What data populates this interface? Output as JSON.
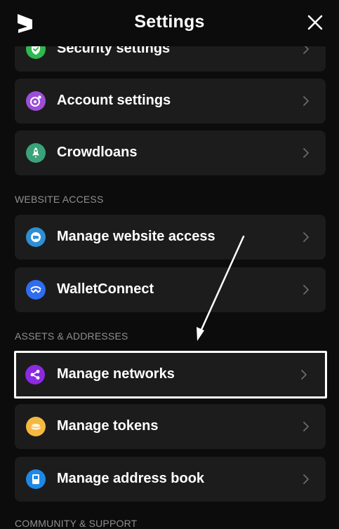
{
  "header": {
    "title": "Settings",
    "logo": "subwallet-logo",
    "close_icon": "close-icon"
  },
  "sections": {
    "website_access": "WEBSITE ACCESS",
    "assets_addresses": "ASSETS & ADDRESSES",
    "community_support": "COMMUNITY & SUPPORT"
  },
  "items": {
    "security": {
      "label": "Security settings",
      "icon": "shield-check-icon",
      "color": "#2fb84f"
    },
    "account": {
      "label": "Account settings",
      "icon": "account-settings-icon",
      "color": "#9c4fd6"
    },
    "crowdloans": {
      "label": "Crowdloans",
      "icon": "rocket-icon",
      "color": "#3aa37a"
    },
    "website": {
      "label": "Manage website access",
      "icon": "globe-icon",
      "color": "#2d8fd6"
    },
    "walletconnect": {
      "label": "WalletConnect",
      "icon": "walletconnect-icon",
      "color": "#2f6cf0"
    },
    "networks": {
      "label": "Manage networks",
      "icon": "share-network-icon",
      "color": "#8a2be2"
    },
    "tokens": {
      "label": "Manage tokens",
      "icon": "coins-icon",
      "color": "#f5b942"
    },
    "addressbook": {
      "label": "Manage address book",
      "icon": "book-icon",
      "color": "#1e88e5"
    }
  },
  "annotation": {
    "type": "pointer-arrow",
    "target": "Manage networks",
    "color": "#ffffff"
  }
}
